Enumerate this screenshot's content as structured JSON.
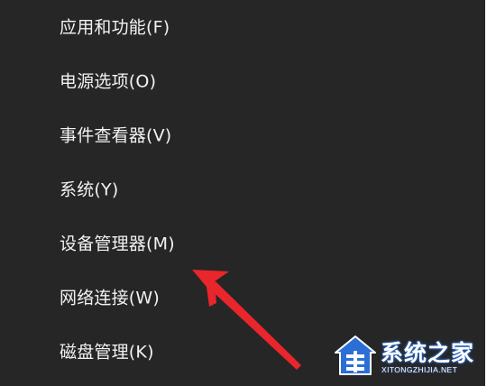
{
  "menu": {
    "items": [
      {
        "label": "应用和功能(F)"
      },
      {
        "label": "电源选项(O)"
      },
      {
        "label": "事件查看器(V)"
      },
      {
        "label": "系统(Y)"
      },
      {
        "label": "设备管理器(M)"
      },
      {
        "label": "网络连接(W)"
      },
      {
        "label": "磁盘管理(K)"
      }
    ]
  },
  "annotation": {
    "icon": "red-arrow",
    "color": "#e8262b"
  },
  "watermark": {
    "name": "系统之家",
    "url": "XITONGZHIJIA.NET",
    "icon": "house-logo-icon",
    "color": "#2b6fd6"
  },
  "colors": {
    "menu_background": "#262626",
    "text": "#f2f2f2"
  }
}
